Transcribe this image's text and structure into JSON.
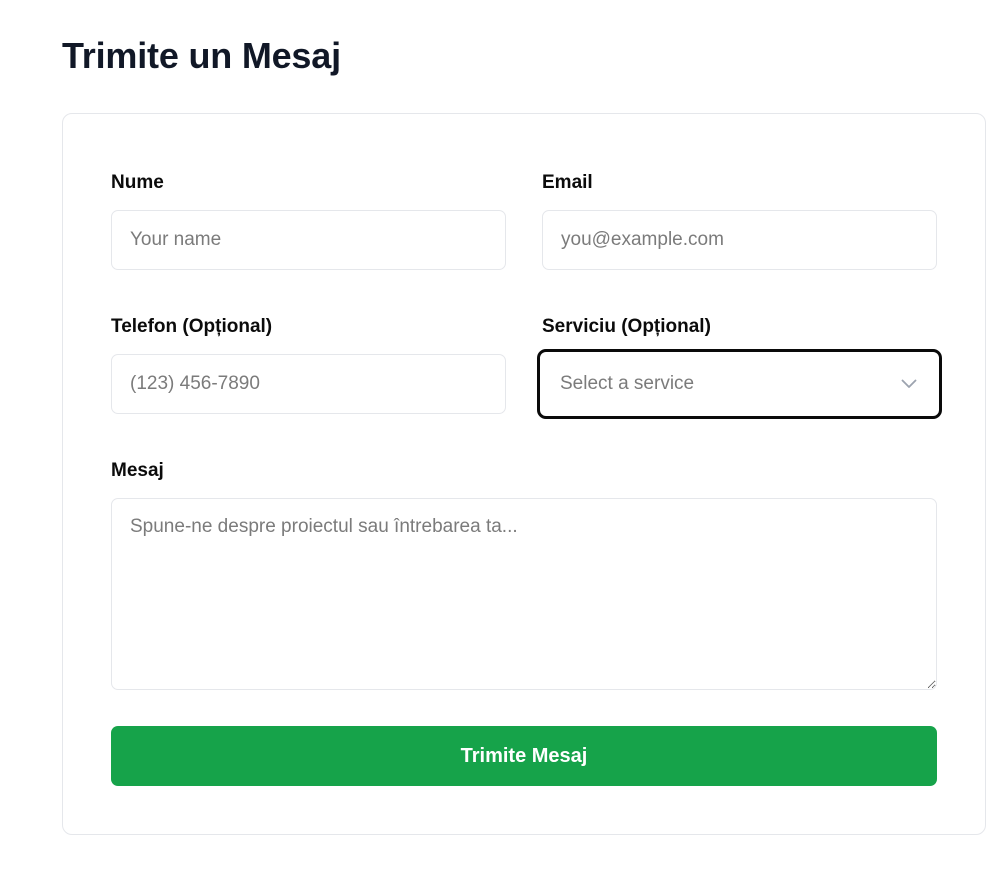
{
  "page": {
    "title": "Trimite un Mesaj"
  },
  "form": {
    "name": {
      "label": "Nume",
      "placeholder": "Your name",
      "value": ""
    },
    "email": {
      "label": "Email",
      "placeholder": "you@example.com",
      "value": ""
    },
    "phone": {
      "label": "Telefon (Opțional)",
      "placeholder": "(123) 456-7890",
      "value": ""
    },
    "service": {
      "label": "Serviciu (Opțional)",
      "selected": "Select a service",
      "icon": "chevron-down-icon"
    },
    "message": {
      "label": "Mesaj",
      "placeholder": "Spune-ne despre proiectul sau întrebarea ta...",
      "value": ""
    },
    "submit_label": "Trimite Mesaj"
  },
  "colors": {
    "accent": "#16a34a",
    "focus_border": "#0a0a0a",
    "input_border": "#e5e7eb",
    "placeholder": "#7b7b7b"
  }
}
